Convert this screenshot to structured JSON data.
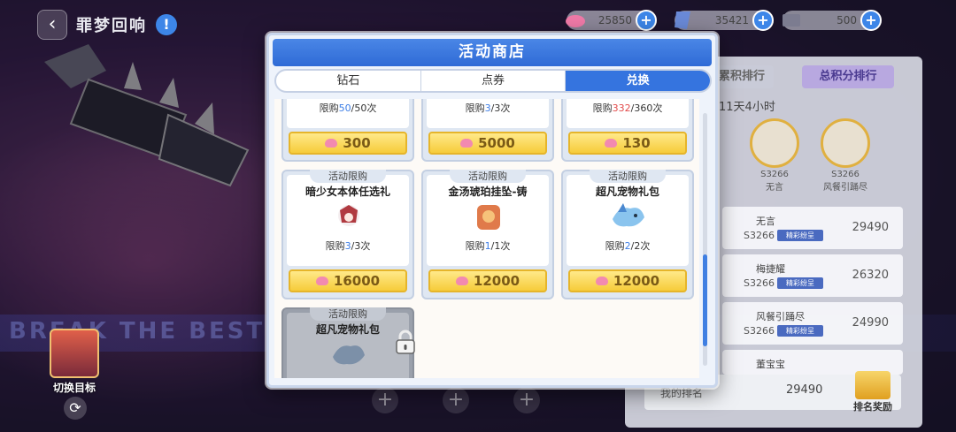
{
  "game": {
    "title": "罪梦回响",
    "switch_target_label": "切换目标",
    "banner_text": "BREAK THE BEST SINGER"
  },
  "currencies": [
    {
      "icon": "heart-gem-icon",
      "value": "25850"
    },
    {
      "icon": "ticket-icon",
      "value": "35421"
    },
    {
      "icon": "card-icon",
      "value": "500"
    }
  ],
  "ranking": {
    "tab_1": "累积排行",
    "tab_2": "总积分排行",
    "time_left": "11天4小时",
    "podium": [
      {
        "server": "S3266",
        "name": "无言"
      },
      {
        "server": "S3266",
        "name": "风餐引踊尽"
      }
    ],
    "rows": [
      {
        "name": "无言",
        "server": "S3266",
        "badge": "精彩纷呈",
        "score": "29490"
      },
      {
        "name": "梅捷耀",
        "server": "S3266",
        "badge": "精彩纷呈",
        "score": "26320"
      },
      {
        "name": "风餐引踊尽",
        "server": "S3266",
        "badge": "精彩纷呈",
        "score": "24990"
      },
      {
        "name": "董宝宝",
        "server": "",
        "badge": "",
        "score": ""
      }
    ],
    "my_label": "我的排名",
    "my_score": "29490",
    "reward_label": "排名奖励"
  },
  "shop": {
    "title": "活动商店",
    "tabs": [
      "钻石",
      "点券",
      "兑换"
    ],
    "active_tab": "兑换",
    "tag_label": "活动限购",
    "limit_prefix": "限购",
    "limit_suffix": "次",
    "items": [
      {
        "name": "",
        "icon": "gift-box-icon",
        "bought": "50",
        "total": "50",
        "price": "300",
        "highlight": "blue"
      },
      {
        "name": "",
        "icon": "crystal-box-icon",
        "bought": "3",
        "total": "3",
        "price": "5000",
        "highlight": "blue"
      },
      {
        "name": "",
        "icon": "character-icon",
        "bought": "332",
        "total": "360",
        "price": "130",
        "highlight": "red"
      },
      {
        "name": "暗少女本体任选礼",
        "icon": "character-gift-icon",
        "bought": "3",
        "total": "3",
        "price": "16000",
        "highlight": "blue"
      },
      {
        "name": "金汤琥珀挂坠-铸",
        "icon": "amber-pendant-icon",
        "bought": "1",
        "total": "1",
        "price": "12000",
        "highlight": "blue"
      },
      {
        "name": "超凡宠物礼包",
        "icon": "pet-dragon-icon",
        "bought": "2",
        "total": "2",
        "price": "12000",
        "highlight": "blue"
      },
      {
        "name": "超凡宠物礼包",
        "icon": "pet-dragon-icon",
        "locked": true
      }
    ]
  },
  "colors": {
    "header_blue": "#2f6bd6",
    "price_yellow": "#f6cc3a",
    "limit_blue": "#3d7ee6",
    "limit_red": "#e24a4a"
  }
}
